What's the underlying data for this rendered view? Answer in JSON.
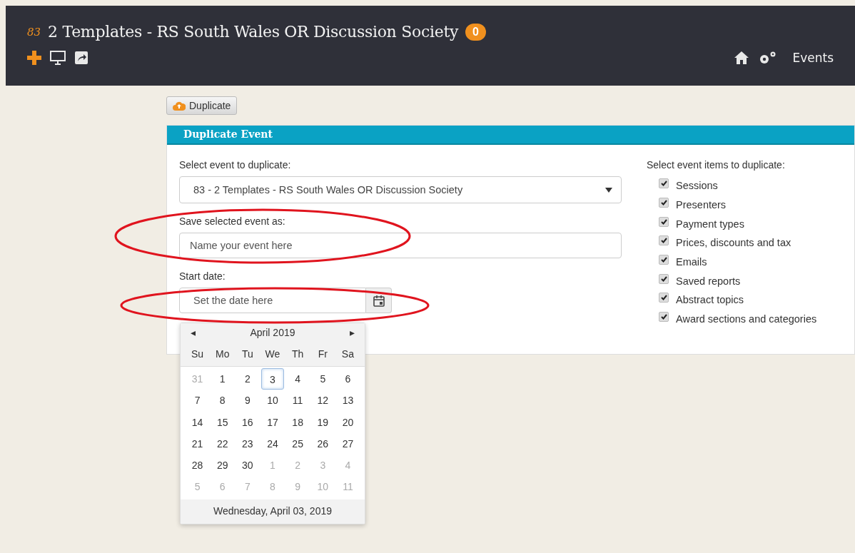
{
  "header": {
    "event_number": "83",
    "title": "2 Templates - RS South Wales OR Discussion Society",
    "badge": "0",
    "nav_label": "Events"
  },
  "duplicate_button": "Duplicate",
  "panel": {
    "title": "Duplicate Event",
    "select_label": "Select event to duplicate:",
    "select_value": "83 - 2 Templates - RS South Wales OR Discussion Society",
    "save_label": "Save selected event as:",
    "save_placeholder": "Name your event here",
    "date_label": "Start date:",
    "date_placeholder": "Set the date here",
    "items_label": "Select event items to duplicate:",
    "items": [
      {
        "label": "Sessions",
        "checked": true
      },
      {
        "label": "Presenters",
        "checked": true
      },
      {
        "label": "Payment types",
        "checked": true
      },
      {
        "label": "Prices, discounts and tax",
        "checked": true
      },
      {
        "label": "Emails",
        "checked": true
      },
      {
        "label": "Saved reports",
        "checked": true
      },
      {
        "label": "Abstract topics",
        "checked": true
      },
      {
        "label": "Award sections and categories",
        "checked": true
      }
    ]
  },
  "calendar": {
    "prev": "◂",
    "month": "April 2019",
    "next": "▸",
    "weekdays": [
      "Su",
      "Mo",
      "Tu",
      "We",
      "Th",
      "Fr",
      "Sa"
    ],
    "weeks": [
      [
        {
          "day": "31",
          "muted": true,
          "selected": false
        },
        {
          "day": "1",
          "muted": false,
          "selected": false
        },
        {
          "day": "2",
          "muted": false,
          "selected": false
        },
        {
          "day": "3",
          "muted": false,
          "selected": true
        },
        {
          "day": "4",
          "muted": false,
          "selected": false
        },
        {
          "day": "5",
          "muted": false,
          "selected": false
        },
        {
          "day": "6",
          "muted": false,
          "selected": false
        }
      ],
      [
        {
          "day": "7",
          "muted": false,
          "selected": false
        },
        {
          "day": "8",
          "muted": false,
          "selected": false
        },
        {
          "day": "9",
          "muted": false,
          "selected": false
        },
        {
          "day": "10",
          "muted": false,
          "selected": false
        },
        {
          "day": "11",
          "muted": false,
          "selected": false
        },
        {
          "day": "12",
          "muted": false,
          "selected": false
        },
        {
          "day": "13",
          "muted": false,
          "selected": false
        }
      ],
      [
        {
          "day": "14",
          "muted": false,
          "selected": false
        },
        {
          "day": "15",
          "muted": false,
          "selected": false
        },
        {
          "day": "16",
          "muted": false,
          "selected": false
        },
        {
          "day": "17",
          "muted": false,
          "selected": false
        },
        {
          "day": "18",
          "muted": false,
          "selected": false
        },
        {
          "day": "19",
          "muted": false,
          "selected": false
        },
        {
          "day": "20",
          "muted": false,
          "selected": false
        }
      ],
      [
        {
          "day": "21",
          "muted": false,
          "selected": false
        },
        {
          "day": "22",
          "muted": false,
          "selected": false
        },
        {
          "day": "23",
          "muted": false,
          "selected": false
        },
        {
          "day": "24",
          "muted": false,
          "selected": false
        },
        {
          "day": "25",
          "muted": false,
          "selected": false
        },
        {
          "day": "26",
          "muted": false,
          "selected": false
        },
        {
          "day": "27",
          "muted": false,
          "selected": false
        }
      ],
      [
        {
          "day": "28",
          "muted": false,
          "selected": false
        },
        {
          "day": "29",
          "muted": false,
          "selected": false
        },
        {
          "day": "30",
          "muted": false,
          "selected": false
        },
        {
          "day": "1",
          "muted": true,
          "selected": false
        },
        {
          "day": "2",
          "muted": true,
          "selected": false
        },
        {
          "day": "3",
          "muted": true,
          "selected": false
        },
        {
          "day": "4",
          "muted": true,
          "selected": false
        }
      ],
      [
        {
          "day": "5",
          "muted": true,
          "selected": false
        },
        {
          "day": "6",
          "muted": true,
          "selected": false
        },
        {
          "day": "7",
          "muted": true,
          "selected": false
        },
        {
          "day": "8",
          "muted": true,
          "selected": false
        },
        {
          "day": "9",
          "muted": true,
          "selected": false
        },
        {
          "day": "10",
          "muted": true,
          "selected": false
        },
        {
          "day": "11",
          "muted": true,
          "selected": false
        }
      ]
    ],
    "footer": "Wednesday, April 03, 2019"
  }
}
